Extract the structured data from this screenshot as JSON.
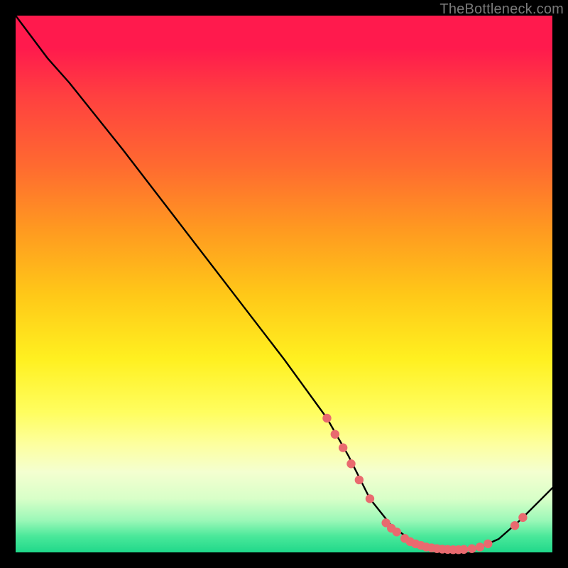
{
  "watermark": "TheBottleneck.com",
  "colors": {
    "background": "#000000",
    "line": "#000000",
    "marker": "#e96a6f"
  },
  "chart_data": {
    "type": "line",
    "title": "",
    "xlabel": "",
    "ylabel": "",
    "xlim": [
      0,
      100
    ],
    "ylim": [
      0,
      100
    ],
    "series": [
      {
        "name": "curve",
        "x": [
          0,
          6,
          10,
          20,
          30,
          40,
          50,
          58,
          62,
          66,
          70,
          74,
          78,
          82,
          86,
          90,
          94,
          100
        ],
        "y": [
          100,
          92,
          87.5,
          75,
          62,
          49,
          36,
          25,
          18,
          10,
          5,
          2,
          0.8,
          0.5,
          0.7,
          2.5,
          6,
          12
        ]
      }
    ],
    "markers": [
      {
        "x": 58.0,
        "y": 25.0
      },
      {
        "x": 59.5,
        "y": 22.0
      },
      {
        "x": 61.0,
        "y": 19.5
      },
      {
        "x": 62.5,
        "y": 16.5
      },
      {
        "x": 64.0,
        "y": 13.5
      },
      {
        "x": 66.0,
        "y": 10.0
      },
      {
        "x": 69.0,
        "y": 5.5
      },
      {
        "x": 70.0,
        "y": 4.5
      },
      {
        "x": 71.0,
        "y": 3.8
      },
      {
        "x": 72.5,
        "y": 2.6
      },
      {
        "x": 73.5,
        "y": 2.0
      },
      {
        "x": 74.5,
        "y": 1.6
      },
      {
        "x": 75.5,
        "y": 1.3
      },
      {
        "x": 76.5,
        "y": 1.0
      },
      {
        "x": 77.5,
        "y": 0.85
      },
      {
        "x": 78.5,
        "y": 0.7
      },
      {
        "x": 79.5,
        "y": 0.6
      },
      {
        "x": 80.5,
        "y": 0.55
      },
      {
        "x": 81.5,
        "y": 0.5
      },
      {
        "x": 82.5,
        "y": 0.5
      },
      {
        "x": 83.5,
        "y": 0.55
      },
      {
        "x": 85.0,
        "y": 0.7
      },
      {
        "x": 86.5,
        "y": 1.0
      },
      {
        "x": 88.0,
        "y": 1.6
      },
      {
        "x": 93.0,
        "y": 5.0
      },
      {
        "x": 94.5,
        "y": 6.5
      }
    ]
  }
}
